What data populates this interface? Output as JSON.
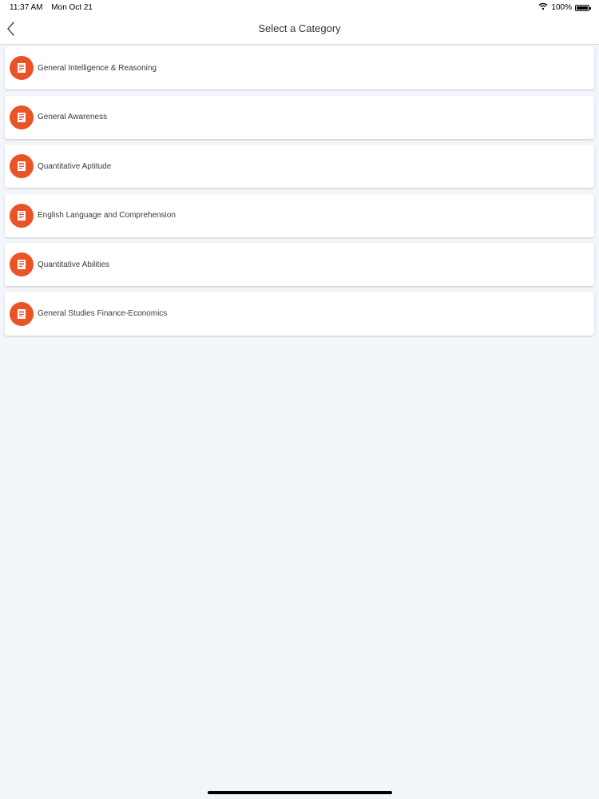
{
  "status_bar": {
    "time": "11:37 AM",
    "date": "Mon Oct 21",
    "battery": "100%",
    "battery_level": 1.0,
    "icons": [
      "wifi-icon",
      "battery-icon"
    ]
  },
  "nav": {
    "title": "Select a Category",
    "back_icon": "chevron-left-icon"
  },
  "categories": [
    {
      "label": "General Intelligence & Reasoning",
      "icon": "document-icon"
    },
    {
      "label": "General Awareness",
      "icon": "document-icon"
    },
    {
      "label": "Quantitative Aptitude",
      "icon": "document-icon"
    },
    {
      "label": "English Language and Comprehension",
      "icon": "document-icon"
    },
    {
      "label": "Quantitative Abilities",
      "icon": "document-icon"
    },
    {
      "label": "General Studies Finance-Economics",
      "icon": "document-icon"
    }
  ],
  "colors": {
    "accent": "#e95326",
    "background": "#f2f5fa",
    "card": "#ffffff"
  }
}
